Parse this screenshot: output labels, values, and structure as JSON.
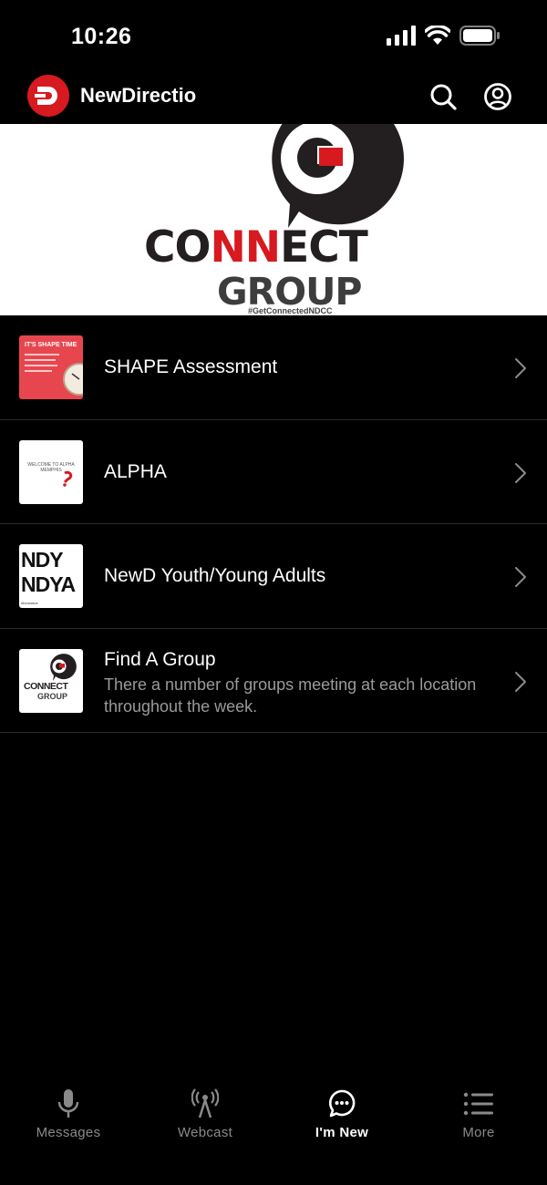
{
  "status_bar": {
    "time": "10:26"
  },
  "header": {
    "title": "NewDirectio"
  },
  "banner": {
    "line1_part1": "CO",
    "line1_part2": "NN",
    "line1_part3": "ECT",
    "line2": "GROUP",
    "hashtag": "#GetConnectedNDCC"
  },
  "items": [
    {
      "title": "SHAPE Assessment",
      "subtitle": "",
      "thumb_text": "IT'S SHAPE TIME"
    },
    {
      "title": "ALPHA",
      "subtitle": "",
      "thumb_text": "WELCOME TO ALPHA MEMPHIS"
    },
    {
      "title": "NewD Youth/Young Adults",
      "subtitle": "",
      "thumb_text_1": "NDY",
      "thumb_text_2": "NDYA",
      "thumb_text_3": "#formative"
    },
    {
      "title": "Find A Group",
      "subtitle": "There a number of groups meeting at each location throughout the week.",
      "thumb_text_1": "CONNECT",
      "thumb_text_2": "GROUP"
    }
  ],
  "tabs": [
    {
      "label": "Messages",
      "icon": "microphone-icon"
    },
    {
      "label": "Webcast",
      "icon": "broadcast-icon"
    },
    {
      "label": "I'm New",
      "icon": "chat-bubble-icon",
      "active": true
    },
    {
      "label": "More",
      "icon": "list-icon"
    }
  ],
  "colors": {
    "brand_red": "#d71920",
    "background": "#000000",
    "muted_text": "#9a9a9a"
  }
}
